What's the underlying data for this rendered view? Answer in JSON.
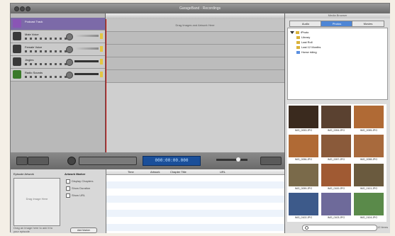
{
  "window": {
    "title": "GarageBand - Recordings"
  },
  "tracks": [
    {
      "name": "Podcast Track",
      "icon": "podcast-icon",
      "selected": true
    },
    {
      "name": "Male Voice",
      "icon": "male-voice-icon",
      "selected": false
    },
    {
      "name": "Female Voice",
      "icon": "female-voice-icon",
      "selected": false
    },
    {
      "name": "Jingles",
      "icon": "jingles-icon",
      "selected": false
    },
    {
      "name": "Radio Sounds",
      "icon": "radio-sounds-icon",
      "selected": false
    }
  ],
  "timeline": {
    "drop_hint": "Drag Images and Artwork Here"
  },
  "transport": {
    "lcd": "000:00:00.000"
  },
  "episode": {
    "artwork_label": "Episode Artwork",
    "artwork_hint": "Drag Image Here",
    "artwork_caption": "Drag an image here to add it to your episode",
    "marker_heading": "Artwork Marker",
    "options": [
      "Display Chapters",
      "Show Duration",
      "Show URL"
    ],
    "add_marker": "Add Marker"
  },
  "marker_list": {
    "columns": [
      "Time",
      "Artwork",
      "Chapter Title",
      "URL"
    ]
  },
  "media_browser": {
    "header": "Media Browser",
    "tabs": [
      "Audio",
      "Photos",
      "Movies"
    ],
    "active_tab": "Photos",
    "tree": [
      {
        "label": "iPhoto",
        "icon": "iphoto-icon",
        "depth": 0,
        "expanded": true
      },
      {
        "label": "Library",
        "icon": "library-icon",
        "depth": 1
      },
      {
        "label": "Last Roll",
        "icon": "last-roll-icon",
        "depth": 1
      },
      {
        "label": "Last 12 Months",
        "icon": "last-12-months-icon",
        "depth": 1
      },
      {
        "label": "Horse riding",
        "icon": "album-icon",
        "depth": 1
      }
    ],
    "photos": [
      {
        "caption": "IMG_0093.JPG",
        "color": "#3a2a1e"
      },
      {
        "caption": "IMG_0094.JPG",
        "color": "#5a4130"
      },
      {
        "caption": "IMG_0095.JPG",
        "color": "#b06a35"
      },
      {
        "caption": "IMG_0096.JPG",
        "color": "#b06a35"
      },
      {
        "caption": "IMG_0097.JPG",
        "color": "#8a5a3a"
      },
      {
        "caption": "IMG_0098.JPG",
        "color": "#a86a3d"
      },
      {
        "caption": "IMG_0099.JPG",
        "color": "#7a6a4a"
      },
      {
        "caption": "IMG_0100.JPG",
        "color": "#a05a33"
      },
      {
        "caption": "IMG_0101.JPG",
        "color": "#6a5a3e"
      },
      {
        "caption": "IMG_0102.JPG",
        "color": "#3d5a8a"
      },
      {
        "caption": "IMG_0103.JPG",
        "color": "#6e6a9a"
      },
      {
        "caption": "IMG_0104.JPG",
        "color": "#5a8a4a"
      }
    ],
    "search_placeholder": "",
    "count": "12 items"
  }
}
